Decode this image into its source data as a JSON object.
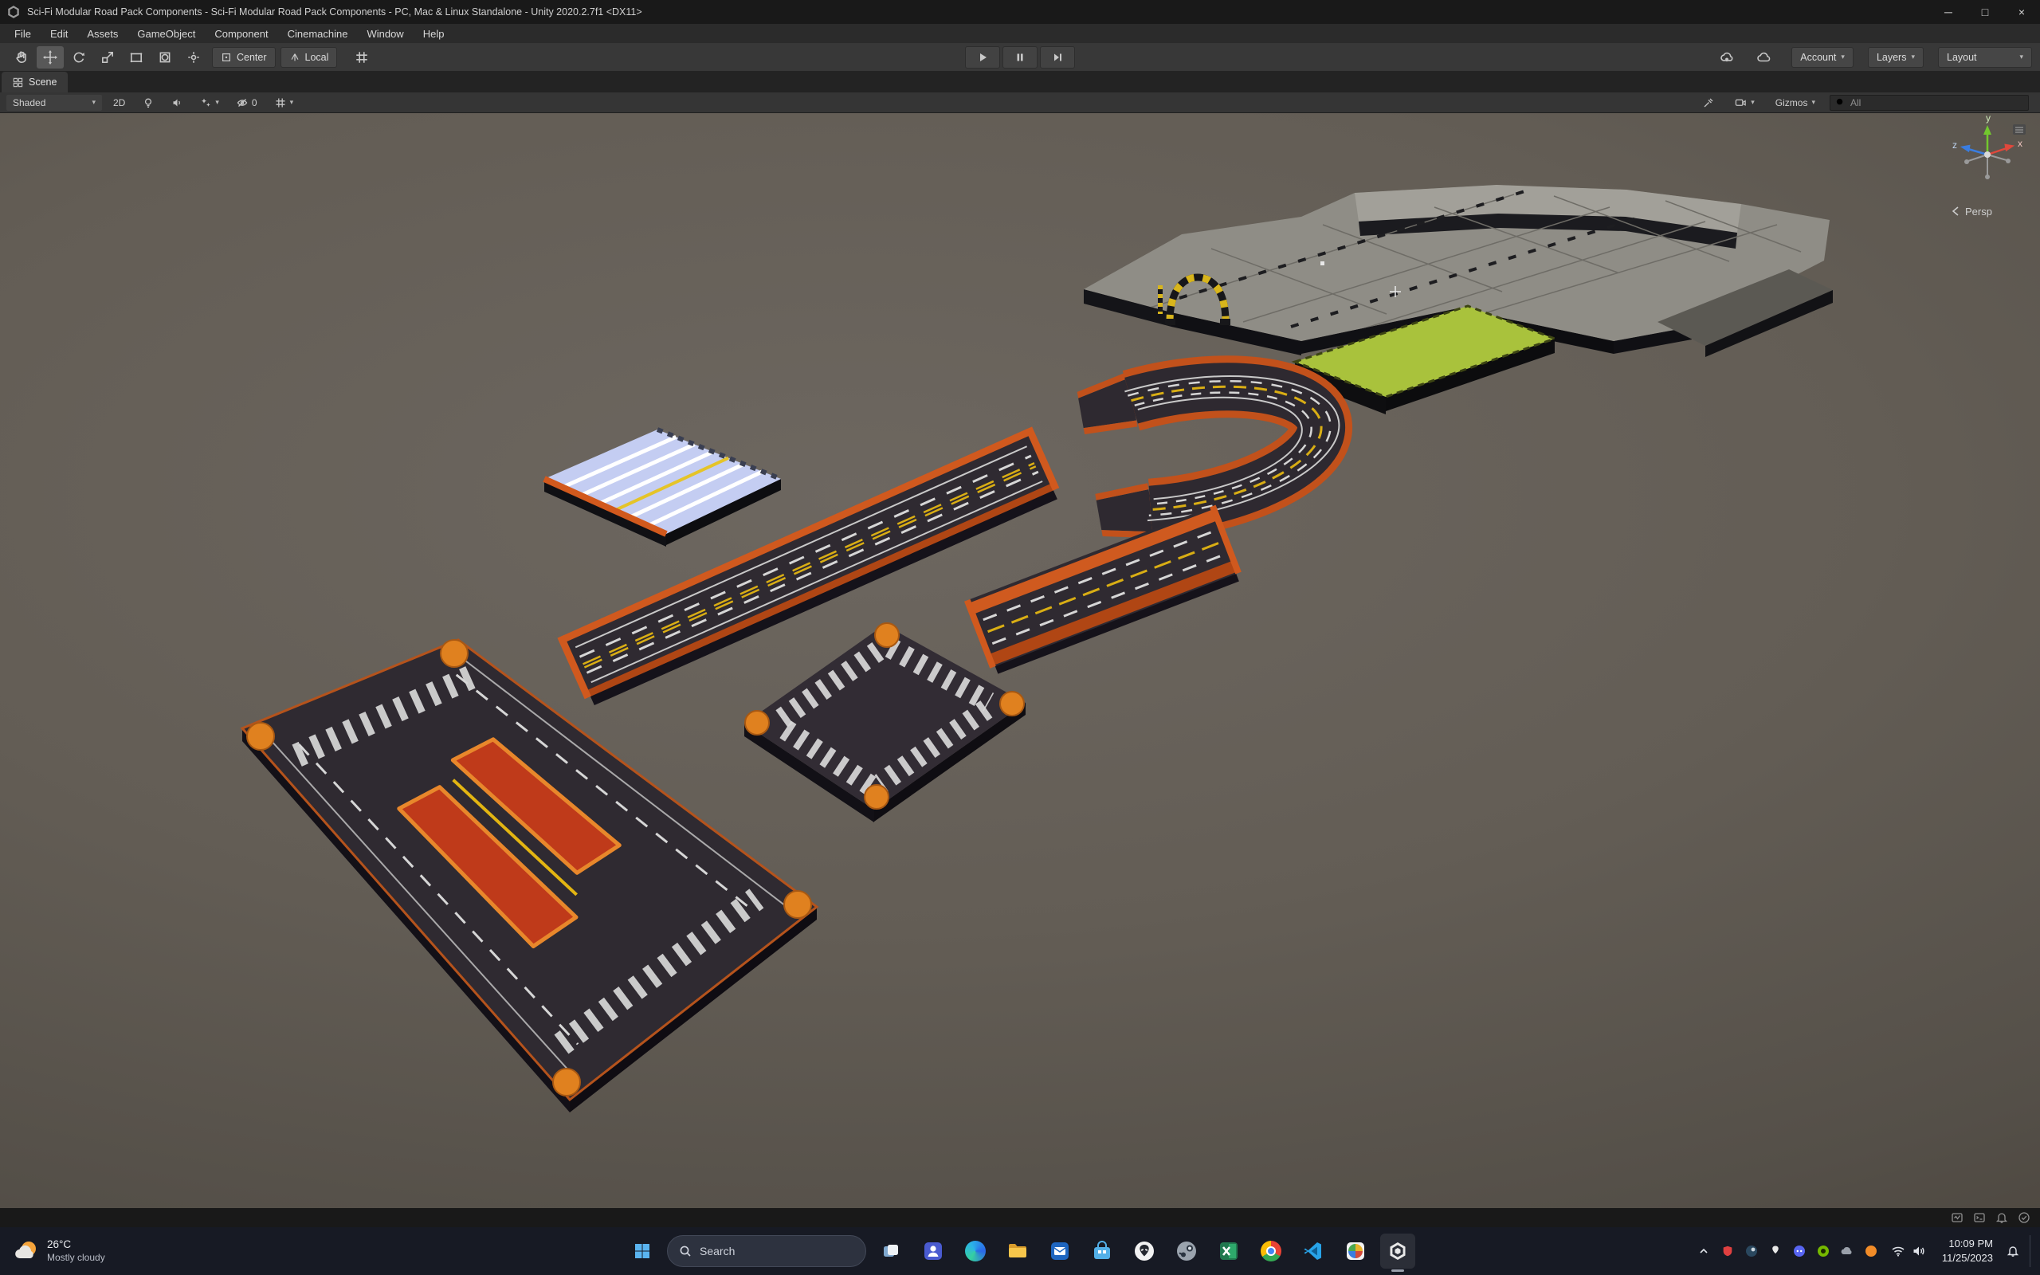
{
  "window": {
    "title": "Sci-Fi Modular Road Pack Components - Sci-Fi Modular Road Pack Components - PC, Mac & Linux Standalone - Unity 2020.2.7f1 <DX11>",
    "controls": {
      "minimize": "─",
      "maximize": "□",
      "close": "×"
    }
  },
  "menu": {
    "items": [
      "File",
      "Edit",
      "Assets",
      "GameObject",
      "Component",
      "Cinemachine",
      "Window",
      "Help"
    ]
  },
  "toolbar": {
    "pivot": "Center",
    "orientation": "Local",
    "account": "Account",
    "layers": "Layers",
    "layout": "Layout"
  },
  "scene": {
    "tab": "Scene",
    "controls": {
      "shading": "Shaded",
      "mode_2d": "2D",
      "hidden_count": "0",
      "gizmos": "Gizmos",
      "search_filter": "All"
    },
    "gizmo": {
      "x": "x",
      "y": "y",
      "z": "z",
      "projection": "Persp"
    }
  },
  "taskbar": {
    "weather": {
      "temperature": "26°C",
      "condition": "Mostly cloudy"
    },
    "search_placeholder": "Search",
    "clock": {
      "time": "10:09 PM",
      "date": "11/25/2023"
    }
  },
  "icons": {
    "caret_down": "▾"
  }
}
